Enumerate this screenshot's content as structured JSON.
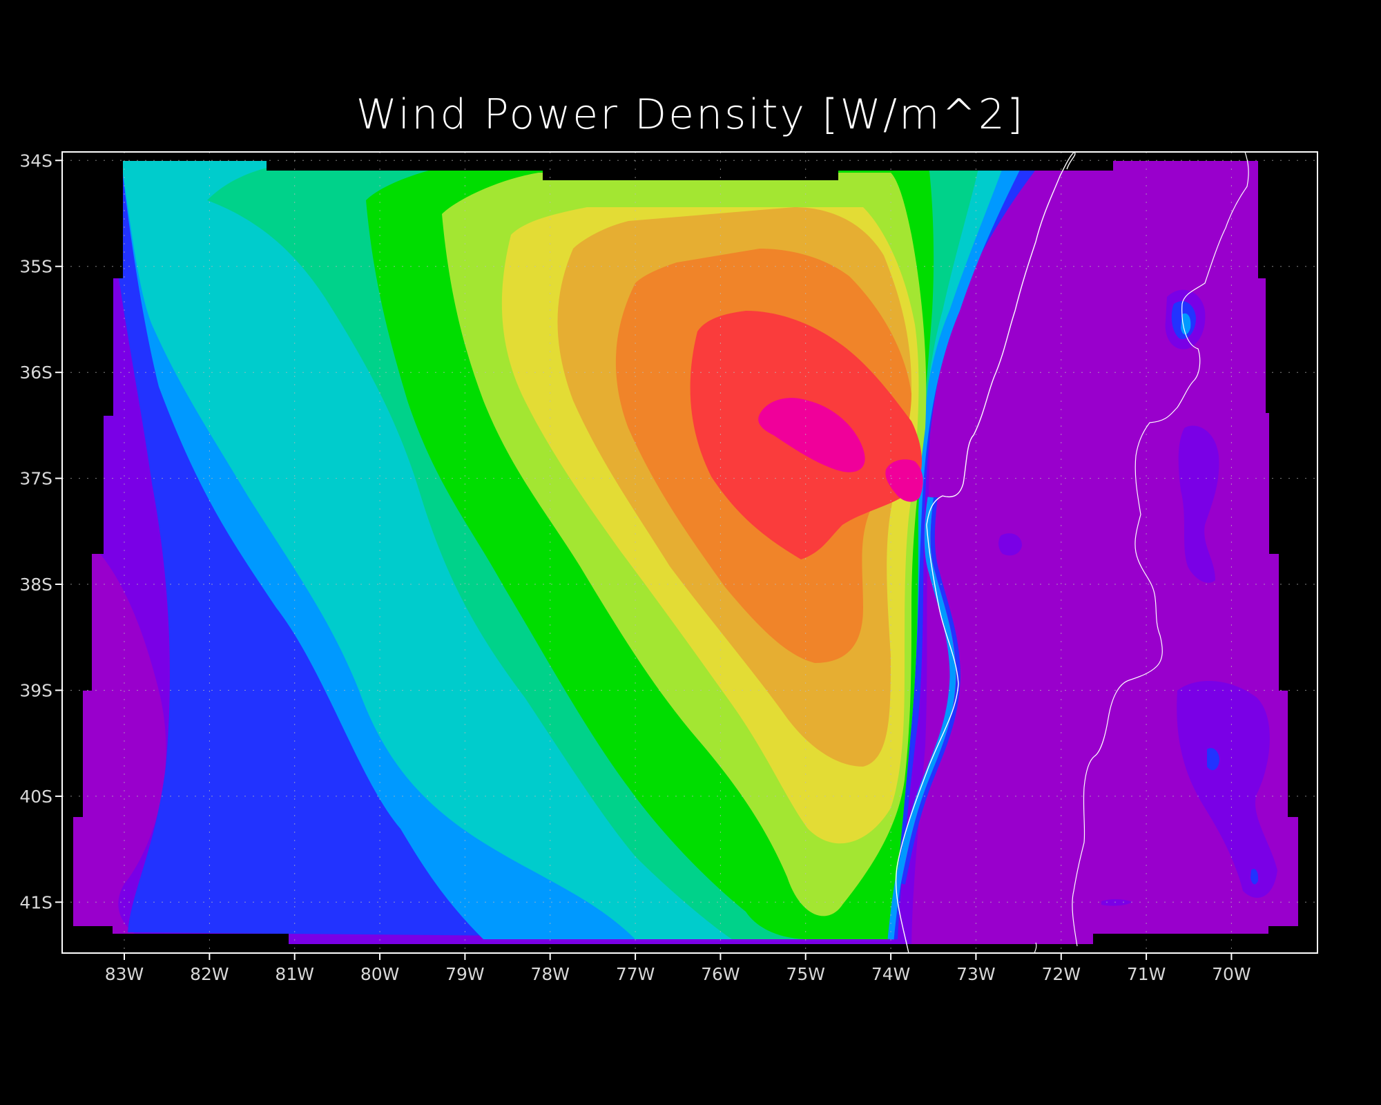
{
  "title": "Wind Power Density [W/m^2]",
  "chart_data": {
    "type": "heatmap",
    "title": "Wind Power Density [W/m^2]",
    "xlabel": "",
    "ylabel": "",
    "x_ticks": [
      "83W",
      "82W",
      "81W",
      "80W",
      "79W",
      "78W",
      "77W",
      "76W",
      "75W",
      "74W",
      "73W",
      "72W",
      "71W",
      "70W"
    ],
    "y_ticks": [
      "34S",
      "35S",
      "36S",
      "37S",
      "38S",
      "39S",
      "40S",
      "41S"
    ],
    "xlim": [
      -83.73,
      -68.99
    ],
    "ylim": [
      -41.48,
      -33.92
    ],
    "grid": true,
    "legend": "none",
    "contour_levels_ordered_low_to_high": [
      "#9900cc",
      "#7a00e6",
      "#2233ff",
      "#0099ff",
      "#00cccc",
      "#00d28a",
      "#00dd00",
      "#a3e632",
      "#e3dc35",
      "#e6ae32",
      "#f08429",
      "#fa3c3c",
      "#f0009a"
    ],
    "features": [
      {
        "name": "maximum",
        "lon": -75.1,
        "lat": -36.6,
        "level_index": 12
      },
      {
        "name": "secondary maximum",
        "lon": -73.8,
        "lat": -37.05,
        "level_index": 12
      },
      {
        "name": "land (Chile / Argentina)",
        "lon_from": -73.7,
        "level_index": 0
      }
    ]
  }
}
